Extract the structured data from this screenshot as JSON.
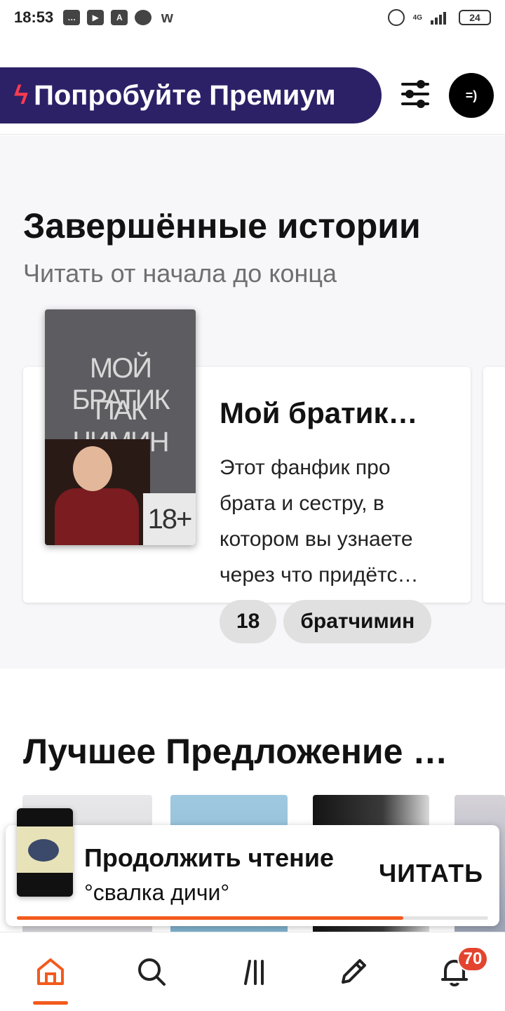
{
  "status_bar": {
    "time": "18:53",
    "network": "4G",
    "battery": "24",
    "notification_icons": [
      "chat-icon",
      "youtube-icon",
      "app-a-icon",
      "message-icon",
      "wattpad-icon"
    ]
  },
  "header": {
    "premium_label": "Попробуйте Премиум",
    "avatar_text": "=)",
    "colors": {
      "premium_bg": "#2c2167",
      "bolt": "#ff3a4f"
    }
  },
  "completed_section": {
    "title": "Завершённые истории",
    "subtitle": "Читать от начала до конца",
    "story": {
      "cover_line1": "МОЙ БРАТИК",
      "cover_line2": "ПАК ЧИМИН",
      "cover_age": "18+",
      "title": "Мой братик…",
      "description": "Этот фанфик про брата и сестру, в котором вы узнаете через что придётс…",
      "tags": [
        "18",
        "братчимин"
      ]
    }
  },
  "best_section": {
    "title": "Лучшее Предложение …"
  },
  "continue_reading": {
    "title": "Продолжить чтение",
    "story_name": "°свалка дичи°",
    "read_button": "ЧИТАТЬ",
    "progress_percent": 82,
    "accent": "#f25a1d"
  },
  "bottom_nav": {
    "items": [
      "home-icon",
      "search-icon",
      "library-icon",
      "write-icon",
      "notifications-icon"
    ],
    "active": "home-icon",
    "notification_count": "70"
  }
}
